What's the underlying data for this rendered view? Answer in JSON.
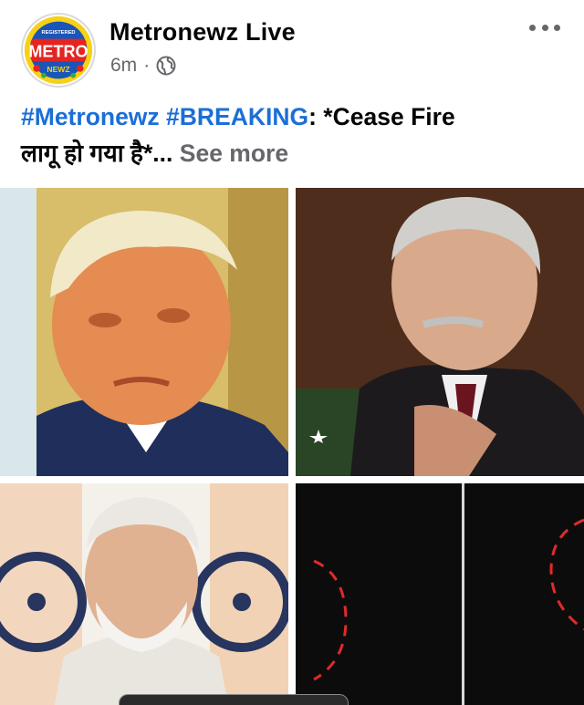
{
  "post": {
    "author": "Metronewz Live",
    "time": "6m",
    "separator": "·",
    "visibility_icon": "globe-icon",
    "more_icon": "more-options-icon",
    "text": {
      "hashtag1": "#Metronewz",
      "hashtag2": "#BREAKING",
      "body_line1": ": *Cease Fire",
      "body_line2": "लागू हो गया है*...",
      "see_more": "See more"
    },
    "avatar": {
      "logo_text": "METRO",
      "logo_sub": "NEWZ",
      "logo_top": "REGISTERED"
    }
  },
  "colors": {
    "hashtag": "#1b6fd6",
    "secondary_text": "#65676b",
    "logo_red": "#e52421",
    "logo_yellow": "#f7d117"
  },
  "photos": [
    {
      "name": "photo-1"
    },
    {
      "name": "photo-2"
    },
    {
      "name": "photo-3"
    },
    {
      "name": "photo-4"
    }
  ]
}
